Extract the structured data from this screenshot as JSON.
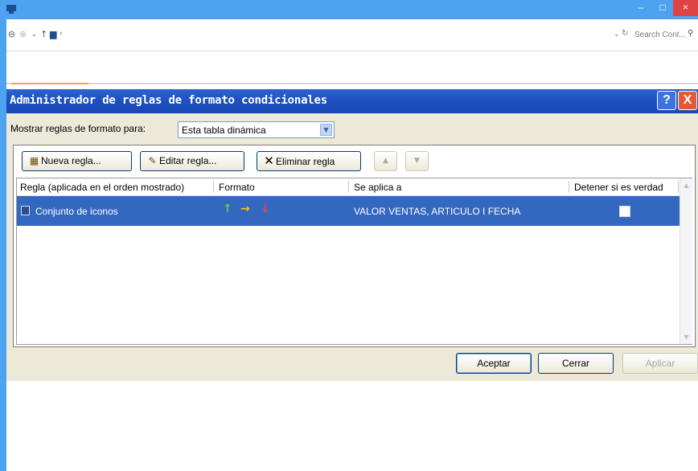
{
  "explorer": {
    "search_placeholder": "Search Cont...",
    "controls": {
      "minimize": "–",
      "maximize": "□",
      "close": "×"
    }
  },
  "dialog": {
    "title": "Administrador de reglas de formato condicionales",
    "help_label": "?",
    "close_label": "X",
    "show_rules_label": "Mostrar reglas de formato para:",
    "show_rules_value": "Esta tabla dinámica",
    "buttons": {
      "new_rule": "Nueva regla...",
      "edit_rule": "Editar regla...",
      "delete_rule": "Eliminar regla"
    },
    "columns": [
      "Regla (aplicada en el orden mostrado)",
      "Formato",
      "Se aplica a",
      "Detener si es verdad"
    ],
    "rules": [
      {
        "rule": "Conjunto de iconos",
        "format_icons": [
          "arrow-up-green-icon",
          "arrow-right-yellow-icon",
          "arrow-down-red-icon"
        ],
        "applies_to": "VALOR VENTAS, ARTICULO I FECHA",
        "stop_if_true": false,
        "selected": true
      }
    ],
    "footer": {
      "ok": "Aceptar",
      "close": "Cerrar",
      "apply": "Aplicar"
    },
    "colors": {
      "title_bar": "#1e4fbe",
      "selection": "#3468c0",
      "dialog_face": "#ece9d8"
    }
  }
}
